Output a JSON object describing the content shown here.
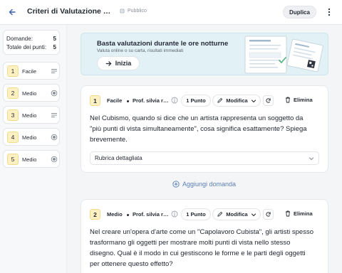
{
  "header": {
    "back_icon": "arrow-left-icon",
    "title": "Criteri di Valutazione per 'Il Cubismo'",
    "visibility": "Pubblico",
    "duplicate_label": "Duplica",
    "more_icon": "kebab-icon"
  },
  "sidebar": {
    "stats": [
      {
        "label": "Domande:",
        "value": "5"
      },
      {
        "label": "Totale dei punti:",
        "value": "5"
      }
    ],
    "items": [
      {
        "num": "1",
        "label": "Facile",
        "icon": "lines-icon"
      },
      {
        "num": "2",
        "label": "Medio",
        "icon": "radio-icon"
      },
      {
        "num": "3",
        "label": "Medio",
        "icon": "lines-icon"
      },
      {
        "num": "4",
        "label": "Medio",
        "icon": "radio-icon"
      },
      {
        "num": "5",
        "label": "Medio",
        "icon": "radio-icon"
      }
    ]
  },
  "banner": {
    "title": "Basta valutazioni durante le ore notturne",
    "subtitle": "Valuta online o su carta, risultati immediati",
    "button": "Inizia"
  },
  "questions": [
    {
      "num": "1",
      "difficulty": "Facile",
      "author": "Prof. silvia rossi",
      "points": "1 Punto",
      "modify": "Modifica",
      "delete": "Elimina",
      "text": "Nel Cubismo, quando si dice che un artista rappresenta un soggetto da \"più punti di vista simultaneamente\", cosa significa esattamente? Spiega brevemente.",
      "rubric": "Rubrica dettagliata"
    },
    {
      "num": "2",
      "difficulty": "Medio",
      "author": "Prof. silvia rossi",
      "points": "1 Punto",
      "modify": "Modifica",
      "delete": "Elimina",
      "text": "Nel creare un'opera d'arte come un \"Capolavoro Cubista\", gli artisti spesso trasformano gli oggetti per mostrare molti punti di vista nello stesso disegno. Qual è il modo in cui gestiscono le forme e le parti degli oggetti per ottenere questo effetto?"
    }
  ],
  "add_question": "Aggiungi domanda",
  "colors": {
    "accent_blue": "#5b7fb3",
    "badge_yellow": "#fdf1c4",
    "banner_bg": "#e2f1f5"
  }
}
